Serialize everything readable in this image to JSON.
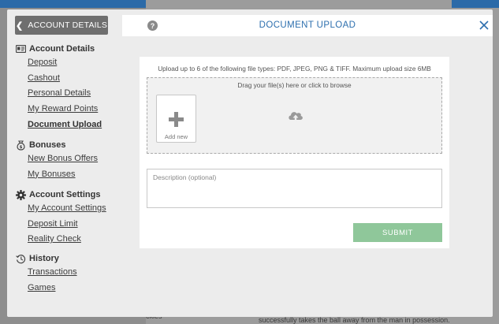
{
  "background": {
    "fragments": [
      "ckles",
      "successfully takes the ball away from the man in possession."
    ]
  },
  "sidebar": {
    "back_label": "ACCOUNT DETAILS",
    "sections": [
      {
        "title": "Account Details",
        "icon": "id-card-icon",
        "items": [
          "Deposit",
          "Cashout",
          "Personal Details",
          "My Reward Points",
          "Document Upload"
        ]
      },
      {
        "title": "Bonuses",
        "icon": "money-bag-icon",
        "items": [
          "New Bonus Offers",
          "My Bonuses"
        ]
      },
      {
        "title": "Account Settings",
        "icon": "gear-icon",
        "items": [
          "My Account Settings",
          "Deposit Limit",
          "Reality Check"
        ]
      },
      {
        "title": "History",
        "icon": "history-icon",
        "items": [
          "Transactions",
          "Games"
        ]
      }
    ],
    "active_item": "Document Upload"
  },
  "header": {
    "title": "DOCUMENT UPLOAD",
    "help_icon": "?"
  },
  "upload": {
    "info": "Upload up to 6 of the following file types: PDF, JPEG, PNG & TIFF. Maximum upload size 6MB",
    "drop_text": "Drag your file(s) here or click to browse",
    "add_new_label": "Add new"
  },
  "description": {
    "placeholder": "Description (optional)",
    "value": ""
  },
  "submit_label": "SUBMIT",
  "colors": {
    "accent": "#2d6fae",
    "submit": "#8fc79a",
    "back_button": "#6f6f6f"
  }
}
